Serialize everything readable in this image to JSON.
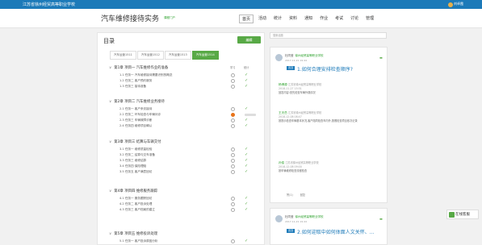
{
  "topbar": {
    "school": "江苏省徐州经贸高等职业学校",
    "user": "刘卓霞"
  },
  "course": {
    "title": "汽车维修接待实务",
    "subtitle": "课程门户"
  },
  "nav": [
    "首页",
    "活动",
    "统计",
    "资料",
    "通知",
    "作业",
    "考试",
    "讨论",
    "管理"
  ],
  "left": {
    "title": "目录",
    "edit": "编辑",
    "tabs": [
      "汽车运营1511",
      "汽车运营1512",
      "汽车运营1513",
      "汽车运营1514"
    ],
    "col_learn": "学习",
    "col_stat": "统计"
  },
  "chapters": [
    {
      "label": "第1章 项目一 汽车维修作业的准备",
      "lessons": [
        "1.1 任务一 汽车维修接待需要识别的概念",
        "1.2 任务二 客户预约服务",
        "1.3 任务三 接待准备"
      ]
    },
    {
      "label": "第2章 项目二 汽车维修业务接待",
      "lessons": [
        "2.1 任务一 客户来访接待",
        "2.2 任务二 环车检查与车辆问诊",
        "2.3 任务三 车辆故障诊断",
        "2.4 任务四 维修项目确认"
      ]
    },
    {
      "label": "第3章 项目三 结算与车辆交付",
      "lessons": [
        "3.1 任务一 维修质量检验",
        "3.2 任务二 结算与交车准备",
        "3.3 任务三 维修结算",
        "3.4 任务四 保险理赔",
        "3.5 任务五 客户满意回访"
      ]
    },
    {
      "label": "第4章 项目四 维修服务跟踪",
      "lessons": [
        "4.1 任务一 服务跟踪回访",
        "4.2 任务二 客户投诉处理",
        "4.3 任务三 客户档案的建立"
      ]
    },
    {
      "label": "第5章 项目五 维修投诉处理",
      "lessons": [
        "5.1 任务一 客户投诉原因分析",
        "5.2 任务二 投诉处理方法与技巧"
      ]
    }
  ],
  "search_placeholder": "搜索话题",
  "posts": [
    {
      "author": "杜同莹",
      "school": "徐州经贸高等职业学校",
      "time": "2017-11-21 19:44",
      "tag": "置顶",
      "title": "1.如何合理安排检查顺序?",
      "replies": [
        {
          "name": "杨博源",
          "school": "江苏省徐州经贸高等职业学校",
          "time": "2018-11-27 15:31",
          "text": "回答内容:首先检查车辆外观情况"
        },
        {
          "name": "王天岳",
          "school": "江苏省徐州经贸高等职业学校",
          "time": "2018-12-08 08:47",
          "text": "按提示检查车辆基本状况,客户陪同检查车内外,按照检查项目依次记录"
        },
        {
          "name": "孙俊",
          "school": "江苏省徐州经贸高等职业学校",
          "time": "2018-12-08 09:00",
          "text": "按车辆维修检查流程检查"
        }
      ],
      "like": "赞(1)",
      "reply": "回复"
    },
    {
      "author": "杜同莹",
      "school": "徐州经贸高等职业学校",
      "time": "2017-11-21 19:44",
      "tag": "置顶",
      "title": "2.如何迎取中如何体面人文关怀、..."
    }
  ],
  "float_btn": "在线客服"
}
